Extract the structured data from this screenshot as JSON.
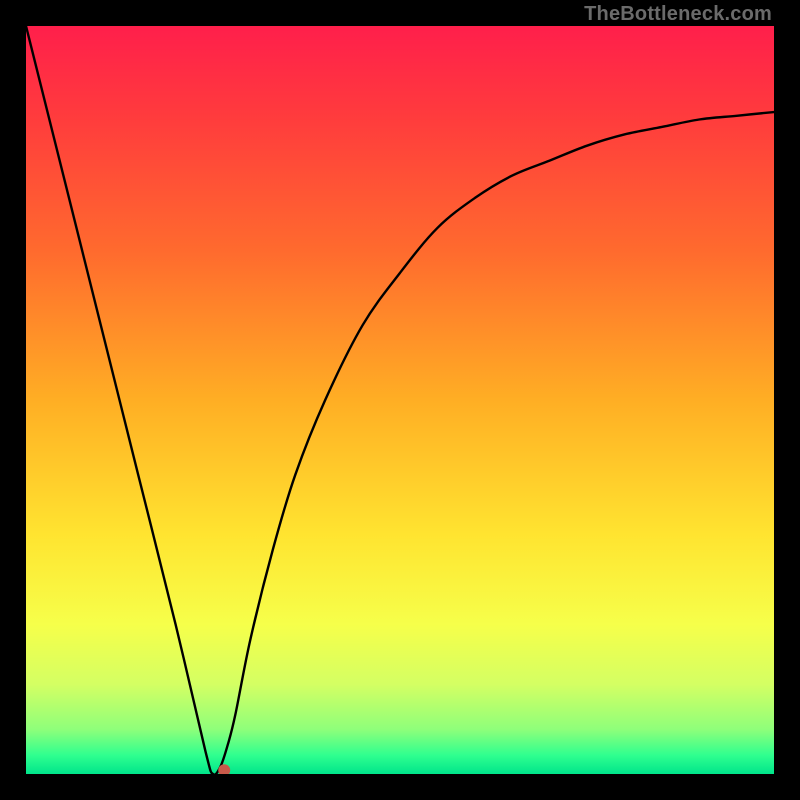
{
  "watermark": "TheBottleneck.com",
  "chart_data": {
    "type": "line",
    "title": "",
    "xlabel": "",
    "ylabel": "",
    "xlim": [
      0,
      100
    ],
    "ylim": [
      0,
      100
    ],
    "grid": false,
    "curve": {
      "x": [
        0,
        5,
        10,
        15,
        20,
        24,
        25,
        26,
        27,
        28,
        30,
        33,
        36,
        40,
        45,
        50,
        55,
        60,
        65,
        70,
        75,
        80,
        85,
        90,
        95,
        100
      ],
      "y": [
        100,
        80,
        60,
        40,
        20,
        3,
        0,
        1,
        4,
        8,
        18,
        30,
        40,
        50,
        60,
        67,
        73,
        77,
        80,
        82,
        84,
        85.5,
        86.5,
        87.5,
        88,
        88.5
      ]
    },
    "marker": {
      "x": 26.5,
      "y": 0.5,
      "color": "#c85a4a",
      "radius": 6
    },
    "gradient_stops": [
      {
        "offset": 0.0,
        "color": "#ff1f4b"
      },
      {
        "offset": 0.12,
        "color": "#ff3b3d"
      },
      {
        "offset": 0.3,
        "color": "#ff6a2e"
      },
      {
        "offset": 0.5,
        "color": "#ffae24"
      },
      {
        "offset": 0.68,
        "color": "#ffe430"
      },
      {
        "offset": 0.8,
        "color": "#f6ff4a"
      },
      {
        "offset": 0.88,
        "color": "#d4ff63"
      },
      {
        "offset": 0.94,
        "color": "#8fff7a"
      },
      {
        "offset": 0.975,
        "color": "#2fff8f"
      },
      {
        "offset": 1.0,
        "color": "#00e58b"
      }
    ]
  }
}
